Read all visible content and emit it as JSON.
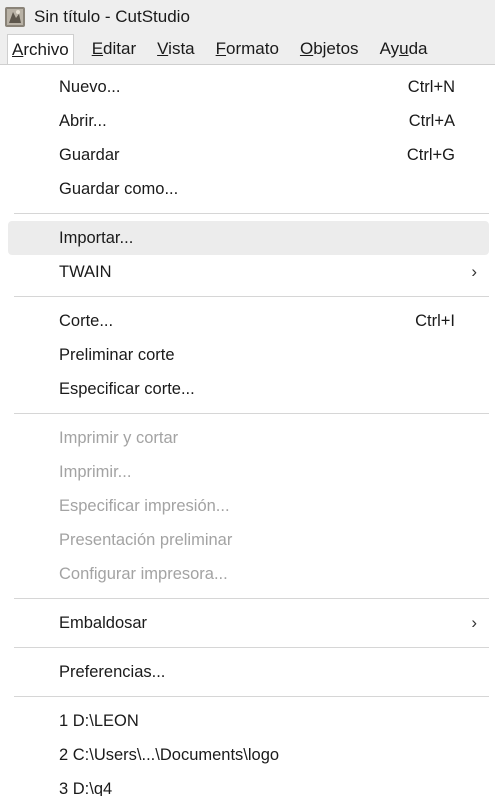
{
  "window": {
    "title": "Sin título - CutStudio"
  },
  "menubar": {
    "items": [
      {
        "pre": "",
        "accel": "A",
        "post": "rchivo"
      },
      {
        "pre": "",
        "accel": "E",
        "post": "ditar"
      },
      {
        "pre": "",
        "accel": "V",
        "post": "ista"
      },
      {
        "pre": "",
        "accel": "F",
        "post": "ormato"
      },
      {
        "pre": "",
        "accel": "O",
        "post": "bjetos"
      },
      {
        "pre": "Ay",
        "accel": "u",
        "post": "da"
      }
    ]
  },
  "file_menu": {
    "nuevo": {
      "label": "Nuevo...",
      "shortcut": "Ctrl+N"
    },
    "abrir": {
      "label": "Abrir...",
      "shortcut": "Ctrl+A"
    },
    "guardar": {
      "label": "Guardar",
      "shortcut": "Ctrl+G"
    },
    "guardar_como": {
      "label": "Guardar como..."
    },
    "importar": {
      "label": "Importar..."
    },
    "twain": {
      "label": "TWAIN"
    },
    "corte": {
      "label": "Corte...",
      "shortcut": "Ctrl+I"
    },
    "preliminar_corte": {
      "label": "Preliminar corte"
    },
    "especificar_corte": {
      "label": "Especificar corte..."
    },
    "imprimir_cortar": {
      "label": "Imprimir y cortar"
    },
    "imprimir": {
      "label": "Imprimir..."
    },
    "especificar_impresion": {
      "label": "Especificar impresión..."
    },
    "presentacion_preliminar": {
      "label": "Presentación preliminar"
    },
    "configurar_impresora": {
      "label": "Configurar impresora..."
    },
    "embaldosar": {
      "label": "Embaldosar"
    },
    "preferencias": {
      "label": "Preferencias..."
    },
    "recent": [
      {
        "label": "1 D:\\LEON"
      },
      {
        "label": "2 C:\\Users\\...\\Documents\\logo"
      },
      {
        "label": "3 D:\\q4"
      }
    ],
    "submenu_arrow": "›"
  },
  "colors": {
    "menubar_bg": "#eeeeee",
    "disabled_text": "#a3a3a3",
    "hover_bg": "#ececec",
    "separator": "#d6d6d6"
  }
}
